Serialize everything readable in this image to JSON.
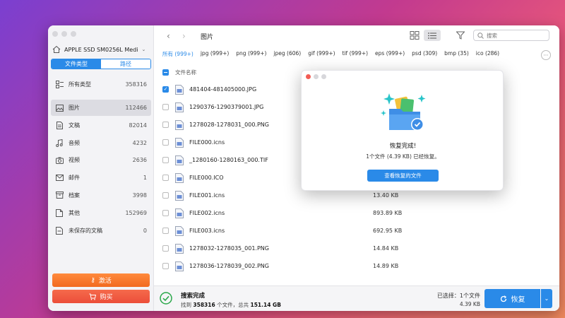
{
  "sidebar": {
    "disk_name": "APPLE SSD SM0256L Medi",
    "segments": [
      "文件类型",
      "路径"
    ],
    "items": [
      {
        "label": "所有类型",
        "count": "358316"
      },
      {
        "label": "图片",
        "count": "112466"
      },
      {
        "label": "文稿",
        "count": "82014"
      },
      {
        "label": "音频",
        "count": "4232"
      },
      {
        "label": "视频",
        "count": "2636"
      },
      {
        "label": "邮件",
        "count": "1"
      },
      {
        "label": "档案",
        "count": "3998"
      },
      {
        "label": "其他",
        "count": "152969"
      },
      {
        "label": "未保存的文稿",
        "count": "0"
      }
    ],
    "activate_label": "激活",
    "buy_label": "购买"
  },
  "header": {
    "title": "图片",
    "search_placeholder": "搜索"
  },
  "tabs": [
    "所有 (999+)",
    "jpg (999+)",
    "png (999+)",
    "jpeg (606)",
    "gif (999+)",
    "tif (999+)",
    "eps (999+)",
    "psd (309)",
    "bmp (35)",
    "ico (286)"
  ],
  "list": {
    "col_name": "文件名称",
    "rows": [
      {
        "name": "481404-481405000.JPG",
        "size": "",
        "checked": true
      },
      {
        "name": "1290376-1290379001.JPG",
        "size": "",
        "checked": false
      },
      {
        "name": "1278028-1278031_000.PNG",
        "size": "",
        "checked": false
      },
      {
        "name": "FILE000.icns",
        "size": "",
        "checked": false
      },
      {
        "name": "_1280160-1280163_000.TIF",
        "size": "",
        "checked": false
      },
      {
        "name": "FILE000.ICO",
        "size": "",
        "checked": false
      },
      {
        "name": "FILE001.icns",
        "size": "13.40 KB",
        "checked": false
      },
      {
        "name": "FILE002.icns",
        "size": "893.89 KB",
        "checked": false
      },
      {
        "name": "FILE003.icns",
        "size": "692.95 KB",
        "checked": false
      },
      {
        "name": "1278032-1278035_001.PNG",
        "size": "14.84 KB",
        "checked": false
      },
      {
        "name": "1278036-1278039_002.PNG",
        "size": "14.89 KB",
        "checked": false
      }
    ]
  },
  "status": {
    "title": "搜索完成",
    "found_prefix": "找到",
    "found_count": "358316",
    "found_mid": "个文件，总共",
    "found_size": "151.14 GB",
    "selected_label": "已选择：1个文件",
    "selected_size": "4.39 KB",
    "recover_label": "恢复"
  },
  "dialog": {
    "title": "恢复完成!",
    "subtitle": "1个文件 (4.39 KB) 已经恢复。",
    "button": "查看恢复的文件"
  }
}
